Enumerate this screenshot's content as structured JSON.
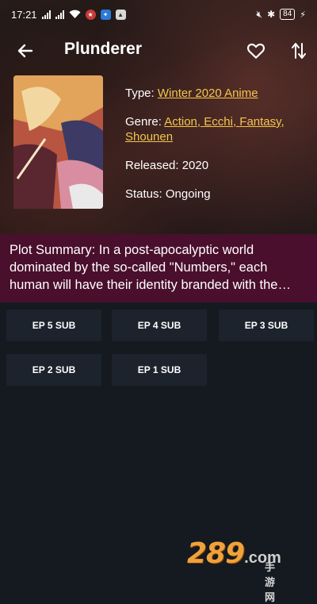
{
  "status_bar": {
    "time": "17:21",
    "battery": "84",
    "icons": [
      "signal-icon",
      "wifi-icon",
      "flag-icon",
      "vpn-icon",
      "gallery-icon",
      "mute-icon",
      "bluetooth-icon",
      "battery-icon",
      "charging-icon"
    ]
  },
  "toolbar": {
    "title": "Plunderer",
    "icons": [
      "back-arrow-icon",
      "heart-icon",
      "sort-icon"
    ]
  },
  "anime": {
    "type_label": "Type: ",
    "type_value": "Winter 2020 Anime",
    "genre_label": "Genre: ",
    "genres": [
      "Action",
      "Ecchi",
      "Fantasy",
      "Shounen"
    ],
    "genre_sep": ", ",
    "released_label": "Released: ",
    "released_value": "2020",
    "status_label": "Status: ",
    "status_value": "Ongoing",
    "summary": "Plot Summary: In a post-apocalyptic world dominated by the so-called \"Numbers,\" each human will have their identity branded with the…"
  },
  "episodes": [
    "EP 5 SUB",
    "EP 4 SUB",
    "EP 3 SUB",
    "EP 2 SUB",
    "EP 1 SUB"
  ],
  "watermark": {
    "number": "289",
    "com": ".com",
    "cn": "手游网"
  },
  "colors": {
    "accent_link": "#f3c64f",
    "summary_bg": "#4a0f2d",
    "page_bg": "#151a21",
    "episode_bg": "#1c232c"
  }
}
